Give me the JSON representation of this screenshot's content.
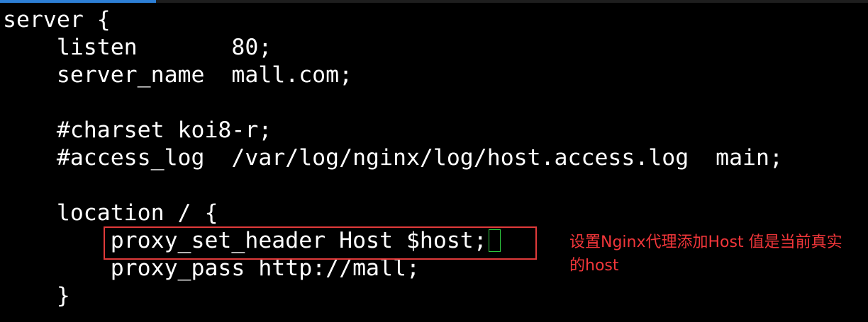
{
  "code": {
    "lines": [
      "server {",
      "    listen       80;",
      "    server_name  mall.com;",
      "",
      "    #charset koi8-r;",
      "    #access_log  /var/log/nginx/log/host.access.log  main;",
      "",
      "    location / {",
      "        proxy_set_header Host $host;",
      "        proxy_pass http://mall;",
      "    }"
    ]
  },
  "annotation": {
    "text": "设置Nginx代理添加Host 值是当前真实的host"
  },
  "colors": {
    "background": "#000000",
    "code_text": "#ffffff",
    "highlight_border": "#e03a3a",
    "annotation_text": "#f2363a",
    "cursor": "#2ecc40"
  }
}
